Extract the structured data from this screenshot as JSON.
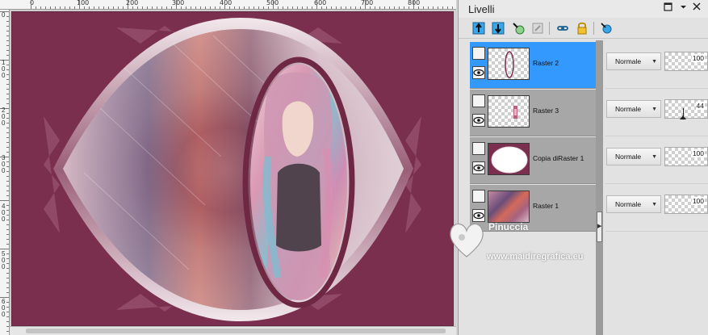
{
  "rulers": {
    "top_labels": [
      "0",
      "100",
      "200",
      "300",
      "400",
      "500",
      "600",
      "700",
      "800"
    ],
    "left_labels": [
      "0",
      "1\n0\n0",
      "2\n0\n0",
      "3\n0\n0",
      "4\n0\n0",
      "5\n0\n0",
      "6\n0\n0"
    ]
  },
  "colors": {
    "canvas_bg": "#7a2f4e",
    "frame": "#702a47",
    "selection": "#3399ff"
  },
  "panel": {
    "title": "Livelli",
    "window_buttons": [
      "restore-icon",
      "pin-icon",
      "close-icon"
    ],
    "toolbar_icons": [
      "new-raster-layer-icon",
      "new-vector-layer-icon",
      "new-adjustment-layer-icon",
      "new-mask-layer-icon",
      "layer-link-icon",
      "lock-icon",
      "layer-properties-icon"
    ]
  },
  "layers": [
    {
      "name": "Raster 2",
      "blend_mode": "Normale",
      "opacity": "100",
      "selected": true
    },
    {
      "name": "Raster 3",
      "blend_mode": "Normale",
      "opacity": "44",
      "selected": false
    },
    {
      "name": "Copia diRaster 1",
      "blend_mode": "Normale",
      "opacity": "100",
      "selected": false
    },
    {
      "name": "Raster 1",
      "blend_mode": "Normale",
      "opacity": "100",
      "selected": false
    }
  ],
  "watermark": {
    "name": "Pinuccia",
    "url": "www.maidiregrafica.eu"
  }
}
